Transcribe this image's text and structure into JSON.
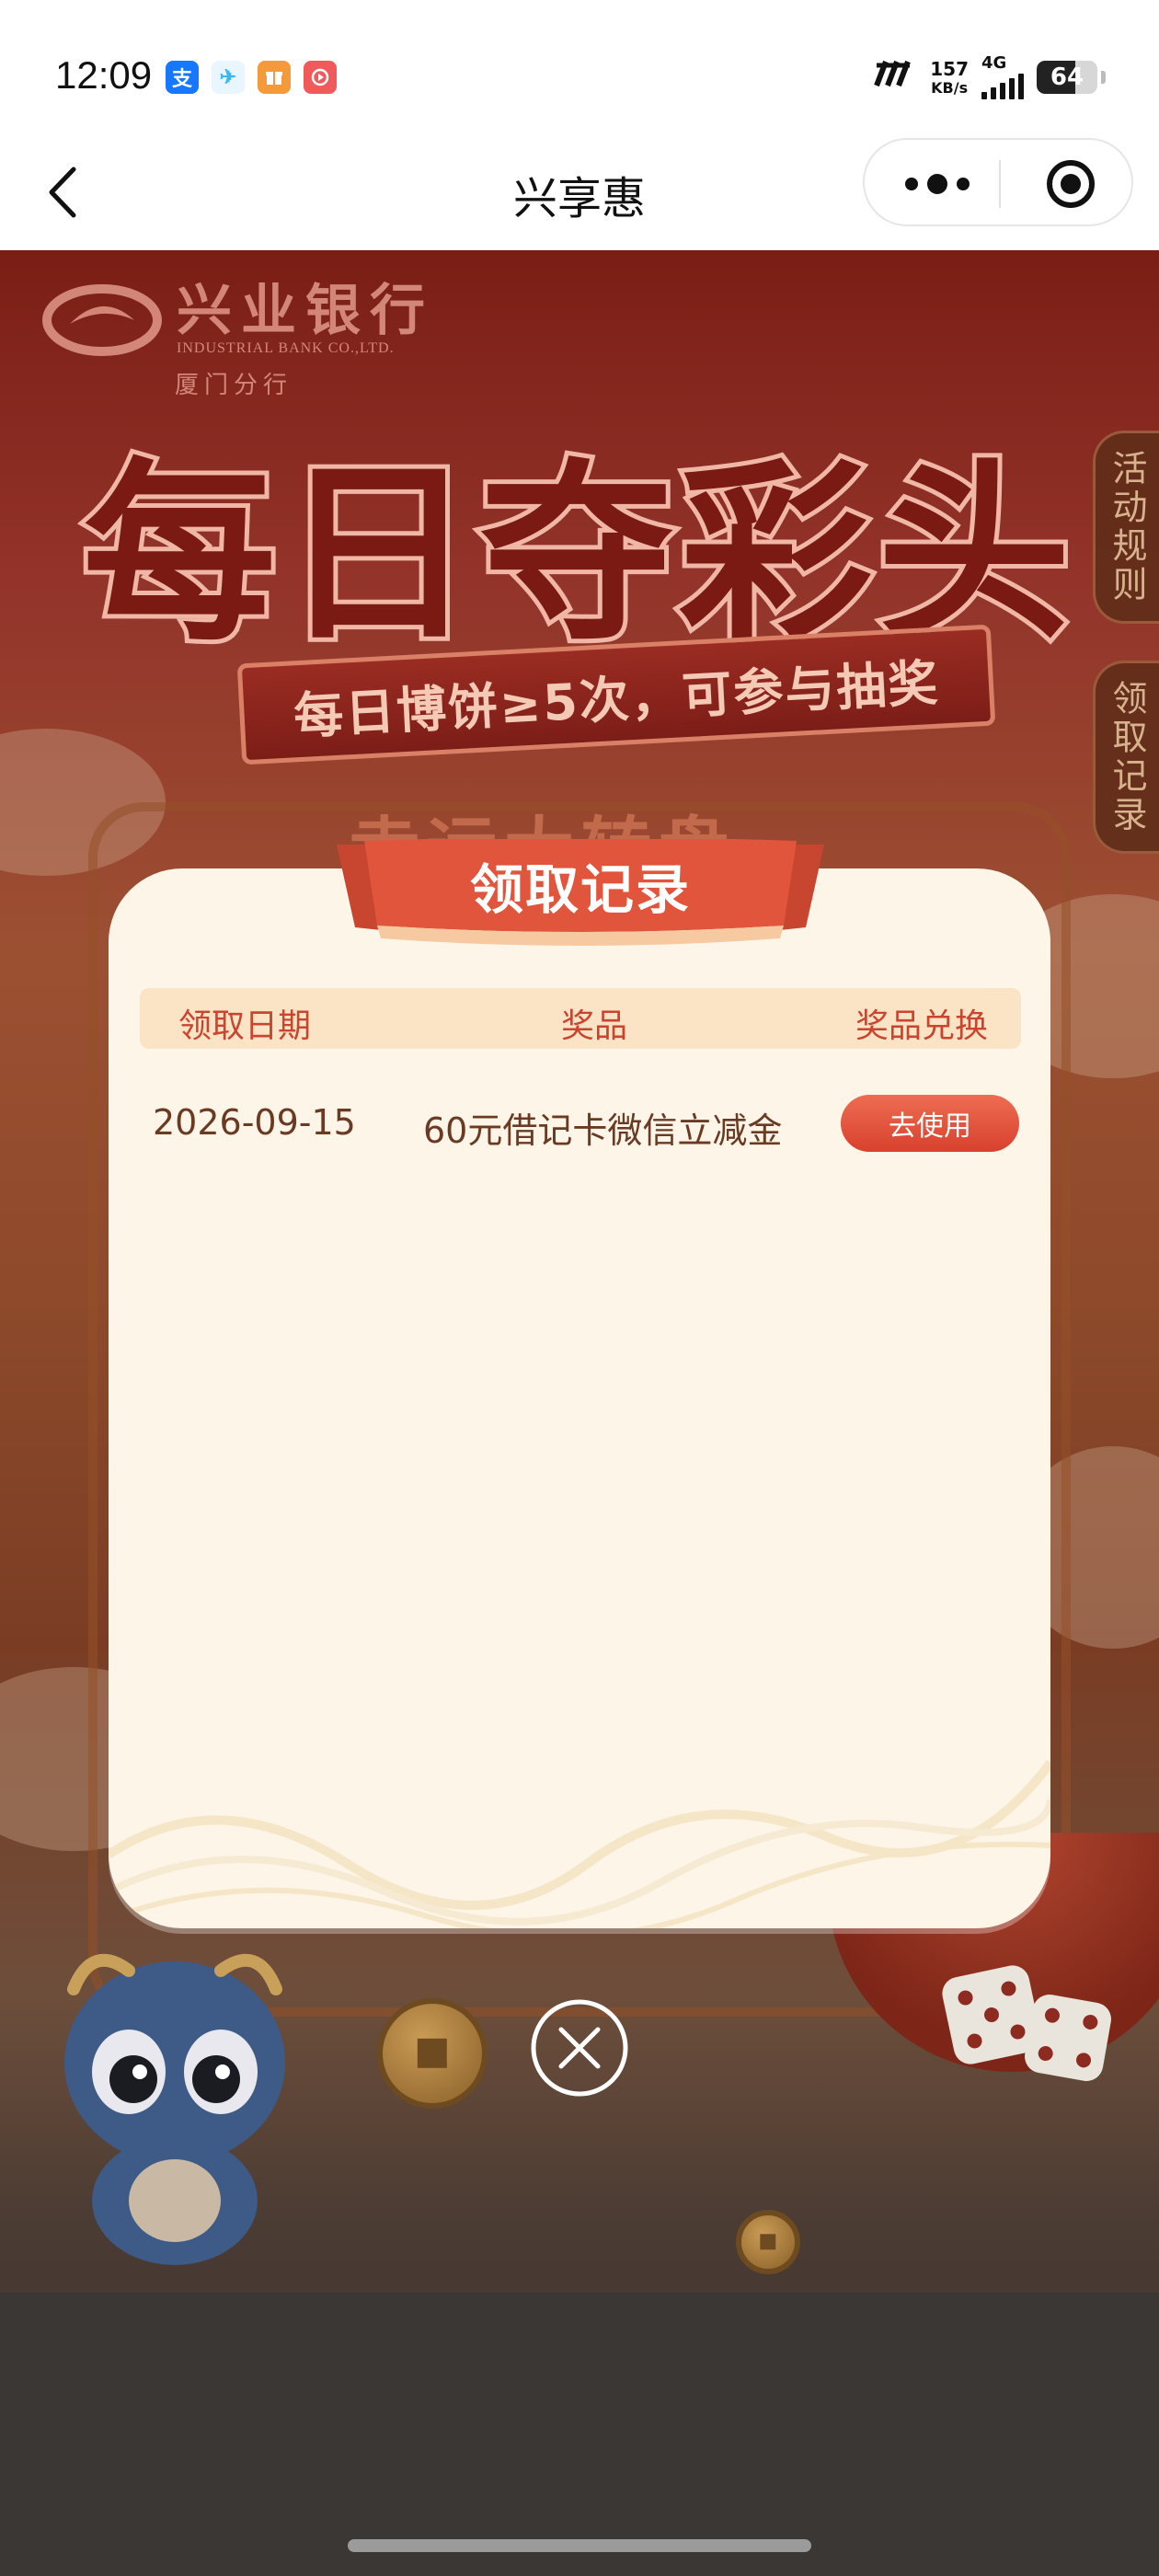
{
  "status_bar": {
    "time": "12:09",
    "notification_icons": [
      {
        "name": "alipay-icon",
        "glyph": "支",
        "color": "#1677ff"
      },
      {
        "name": "paper-plane-app-icon",
        "glyph": "✈",
        "color": "#3fb6f2"
      },
      {
        "name": "shop-app-icon",
        "glyph": "🎁",
        "color": "#f59a3b"
      },
      {
        "name": "video-app-icon",
        "glyph": "▶",
        "color": "#f15a5a"
      }
    ],
    "net_speed_value": "157",
    "net_speed_unit": "KB/s",
    "network_type": "4G",
    "battery_level": "64",
    "battery_fraction": 0.64
  },
  "nav": {
    "title": "兴享惠"
  },
  "background": {
    "bank_name": "兴业银行",
    "bank_name_en": "INDUSTRIAL BANK CO.,LTD.",
    "bank_branch": "厦门分行",
    "hero_title": "每日夺彩头",
    "hero_subtitle": "每日博饼≥5次，可参与抽奖",
    "side_tabs": [
      "活动规则",
      "领取记录"
    ],
    "wheel_title": "幸运大转盘"
  },
  "modal": {
    "title": "领取记录",
    "columns": [
      "领取日期",
      "奖品",
      "奖品兑换"
    ],
    "rows": [
      {
        "date": "2026-09-15",
        "prize": "60元借记卡微信立减金",
        "action_label": "去使用"
      }
    ]
  },
  "colors": {
    "accent": "#d8412d",
    "modal_bg": "#fdf5e8",
    "header_bg": "#fbe3c6",
    "header_text": "#c9452e",
    "row_text": "#6b3a22"
  }
}
